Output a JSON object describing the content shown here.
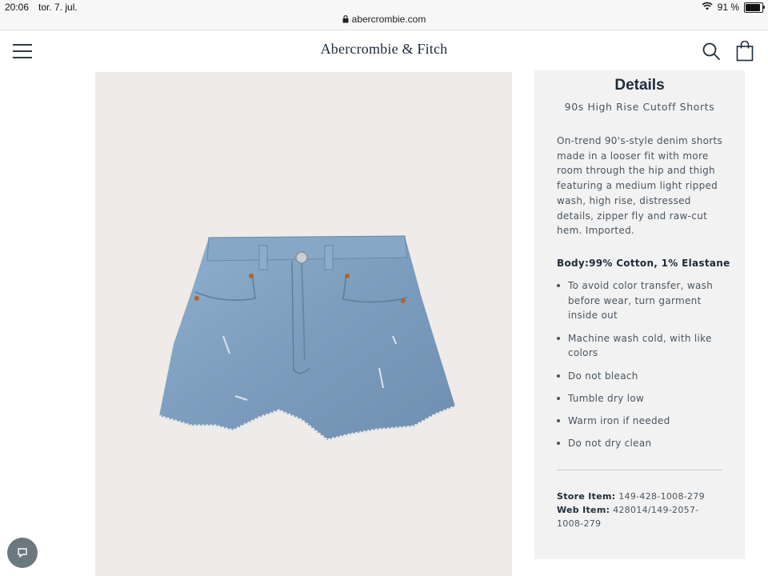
{
  "status_bar": {
    "time": "20:06",
    "date": "tor. 7. jul.",
    "url": "abercrombie.com",
    "battery": "91 %"
  },
  "header": {
    "logo": "Abercrombie & Fitch",
    "icons": [
      "hamburger-menu-icon",
      "search-icon",
      "shopping-bag-icon"
    ]
  },
  "details": {
    "heading": "Details",
    "product_name": "90s High Rise Cutoff Shorts",
    "description": "On-trend 90's-style denim shorts made in a looser fit with more room through the hip and thigh featuring a medium light ripped wash, high rise, distressed details, zipper fly and raw-cut hem. Imported.",
    "composition": "Body:99% Cotton, 1% Elastane",
    "care": [
      "To avoid color transfer, wash before wear, turn garment inside out",
      "Machine wash cold, with like colors",
      "Do not bleach",
      "Tumble dry low",
      "Warm iron if needed",
      "Do not dry clean"
    ],
    "store_item_label": "Store Item:",
    "store_item": "149-428-1008-279",
    "web_item_label": "Web Item:",
    "web_item": "428014/149-2057-1008-279"
  },
  "colors": {
    "brand_navy": "#1d2b3a",
    "panel_bg": "#f2f2f2",
    "image_bg": "#eeebe8",
    "denim": "#7fa0bf"
  }
}
